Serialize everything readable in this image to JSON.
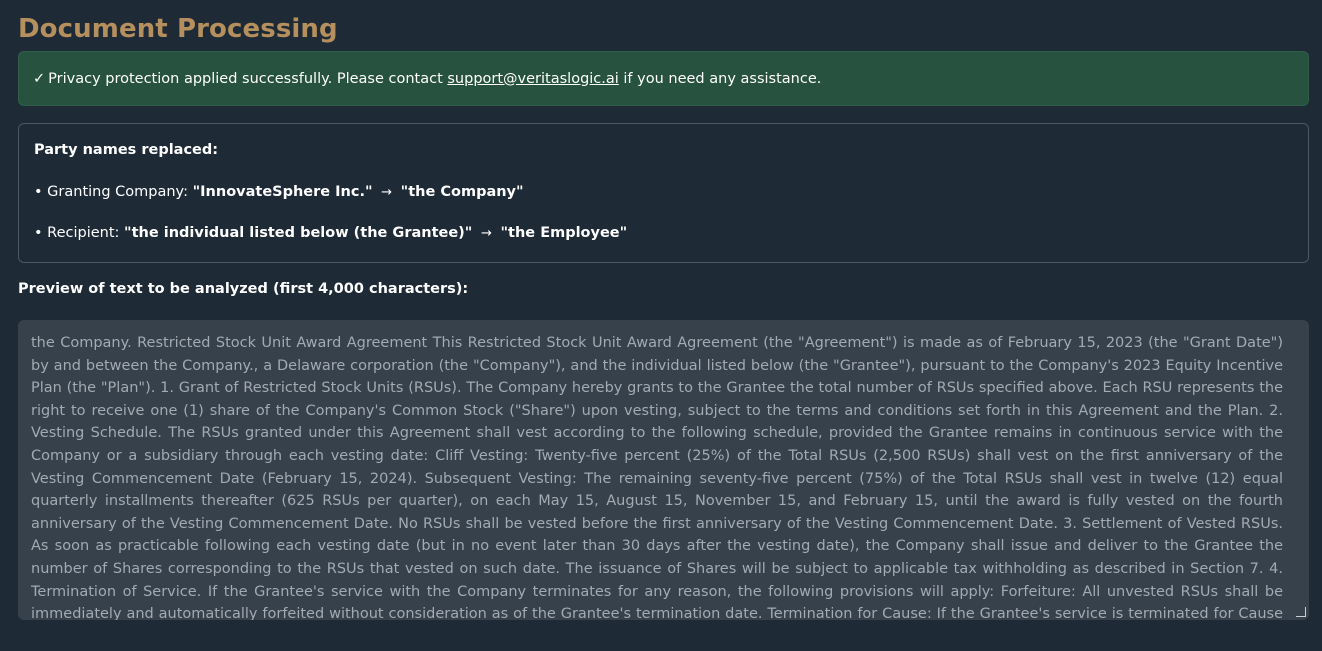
{
  "page": {
    "title": "Document Processing"
  },
  "alert": {
    "check": "✓",
    "text_before": "Privacy protection applied successfully. Please contact",
    "email": "support@veritaslogic.ai",
    "text_after": "if you need any assistance."
  },
  "replacements": {
    "heading": "Party names replaced:",
    "items": [
      {
        "bullet": "•",
        "label": "Granting Company:",
        "from": "\"InnovateSphere Inc.\"",
        "arrow": "→",
        "to": "\"the Company\""
      },
      {
        "bullet": "•",
        "label": "Recipient:",
        "from": "\"the individual listed below (the Grantee)\"",
        "arrow": "→",
        "to": "\"the Employee\""
      }
    ]
  },
  "preview": {
    "label": "Preview of text to be analyzed (first 4,000 characters):",
    "text": "the Company. Restricted Stock Unit Award Agreement This Restricted Stock Unit Award Agreement (the \"Agreement\") is made as of February 15, 2023 (the \"Grant Date\") by and between the Company., a Delaware corporation (the \"Company\"), and the individual listed below (the \"Grantee\"), pursuant to the Company's 2023 Equity Incentive Plan (the \"Plan\"). 1. Grant of Restricted Stock Units (RSUs). The Company hereby grants to the Grantee the total number of RSUs specified above. Each RSU represents the right to receive one (1) share of the Company's Common Stock (\"Share\") upon vesting, subject to the terms and conditions set forth in this Agreement and the Plan. 2. Vesting Schedule. The RSUs granted under this Agreement shall vest according to the following schedule, provided the Grantee remains in continuous service with the Company or a subsidiary through each vesting date: Cliff Vesting: Twenty-five percent (25%) of the Total RSUs (2,500 RSUs) shall vest on the first anniversary of the Vesting Commencement Date (February 15, 2024). Subsequent Vesting: The remaining seventy-five percent (75%) of the Total RSUs shall vest in twelve (12) equal quarterly installments thereafter (625 RSUs per quarter), on each May 15, August 15, November 15, and February 15, until the award is fully vested on the fourth anniversary of the Vesting Commencement Date. No RSUs shall be vested before the first anniversary of the Vesting Commencement Date. 3. Settlement of Vested RSUs. As soon as practicable following each vesting date (but in no event later than 30 days after the vesting date), the Company shall issue and deliver to the Grantee the number of Shares corresponding to the RSUs that vested on such date. The issuance of Shares will be subject to applicable tax withholding as described in Section 7. 4. Termination of Service. If the Grantee's service with the Company terminates for any reason, the following provisions will apply: Forfeiture: All unvested RSUs shall be immediately and automatically forfeited without consideration as of the Grantee's termination date. Termination for Cause: If the Grantee's service is terminated for Cause (as defined in the Plan), all RSUs, whether vested or unvested, shall be immediately forfeited. Death or Disability: In the event of the Grantee's termination due to death or Disability (as defined in the Plan), a portion of the unvested RSUs that would have"
  },
  "colors": {
    "background": "#1e2a35",
    "title": "#b5905e",
    "alert_background": "#27523f",
    "card_border": "#4a5866",
    "preview_background": "#36414c",
    "preview_text": "#a2aab2"
  }
}
